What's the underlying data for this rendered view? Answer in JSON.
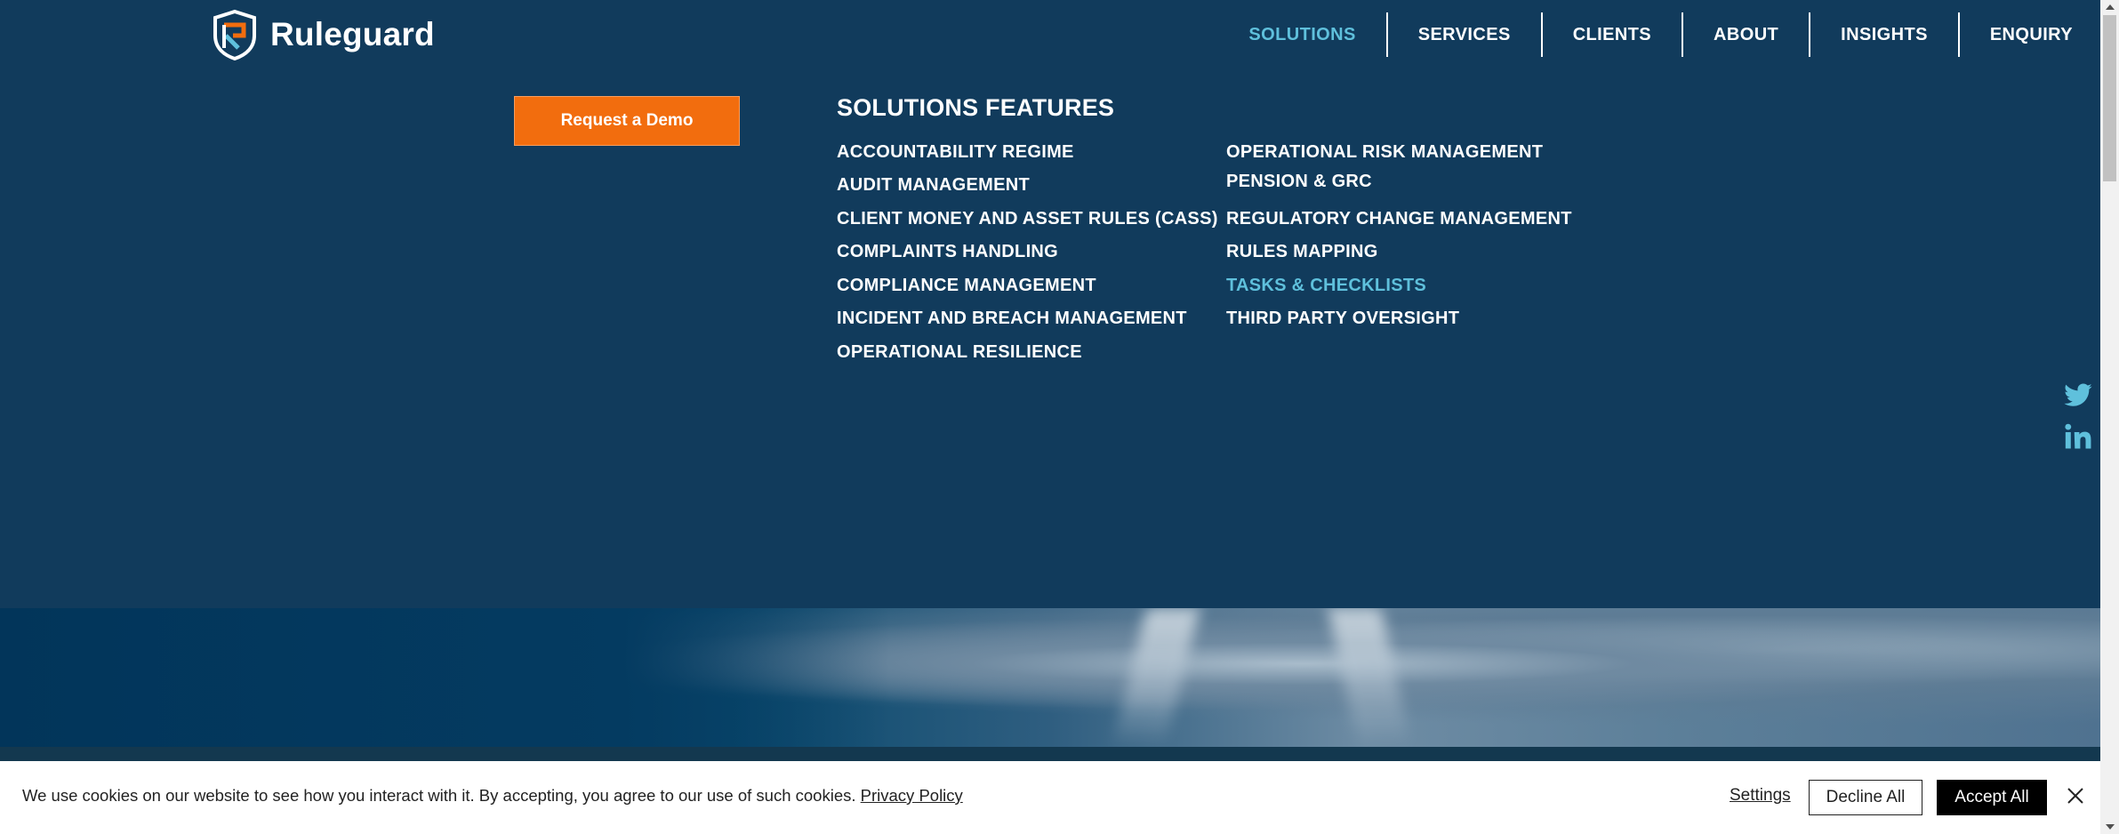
{
  "brand": {
    "name": "Ruleguard"
  },
  "nav": [
    {
      "label": "SOLUTIONS",
      "active": true
    },
    {
      "label": "SERVICES",
      "active": false
    },
    {
      "label": "CLIENTS",
      "active": false
    },
    {
      "label": "ABOUT",
      "active": false
    },
    {
      "label": "INSIGHTS",
      "active": false
    },
    {
      "label": "ENQUIRY",
      "active": false
    }
  ],
  "cta": {
    "demo_label": "Request a Demo"
  },
  "solutions": {
    "title": "SOLUTIONS FEATURES",
    "col1": [
      "ACCOUNTABILITY REGIME",
      "AUDIT MANAGEMENT",
      "CLIENT MONEY AND ASSET RULES (CASS)",
      "COMPLAINTS HANDLING",
      "COMPLIANCE MANAGEMENT",
      "INCIDENT AND BREACH MANAGEMENT",
      "OPERATIONAL RESILIENCE"
    ],
    "col2": [
      "OPERATIONAL RISK MANAGEMENT",
      "PENSION & GRC",
      "REGULATORY CHANGE MANAGEMENT",
      "RULES MAPPING",
      "TASKS & CHECKLISTS",
      "THIRD PARTY OVERSIGHT"
    ],
    "active_item": "TASKS & CHECKLISTS"
  },
  "social": {
    "icons": [
      "twitter-icon",
      "linkedin-icon"
    ],
    "color": "#5fc0dc"
  },
  "cookie": {
    "text": "We use cookies on our website to see how you interact with it. By accepting, you agree to our use of such cookies.",
    "privacy_link": "Privacy Policy",
    "settings_label": "Settings",
    "decline_label": "Decline All",
    "accept_label": "Accept All"
  },
  "colors": {
    "background": "#113b5c",
    "accent": "#5fc0dc",
    "cta": "#f26d0e"
  }
}
